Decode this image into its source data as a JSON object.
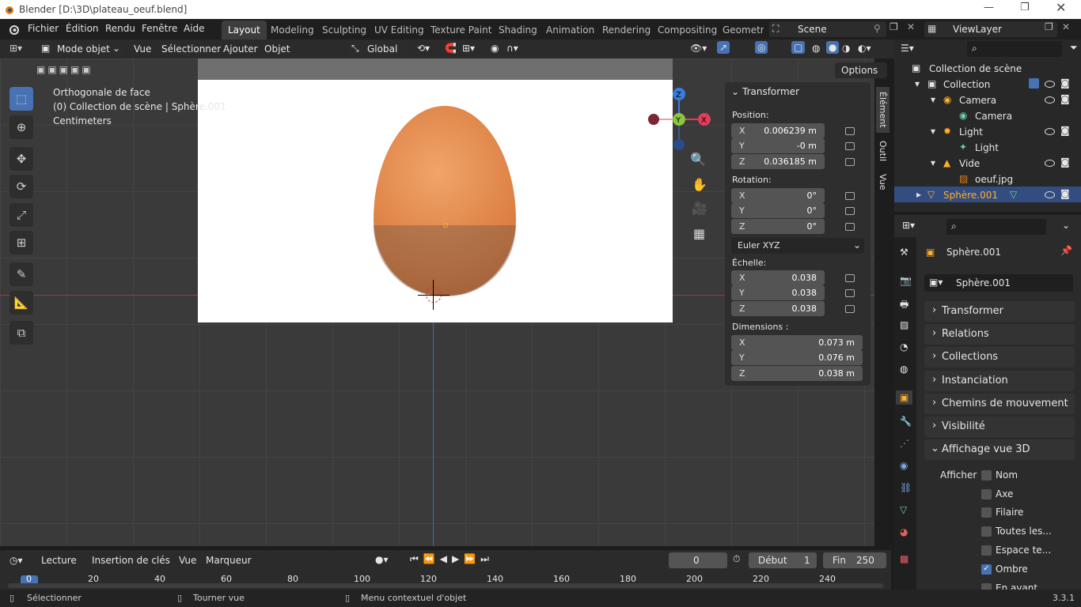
{
  "window": {
    "title": "Blender [D:\\3D\\plateau_oeuf.blend]",
    "version": "3.3.1"
  },
  "menu": [
    "Fichier",
    "Édition",
    "Rendu",
    "Fenêtre",
    "Aide"
  ],
  "workspaces": [
    "Layout",
    "Modeling",
    "Sculpting",
    "UV Editing",
    "Texture Paint",
    "Shading",
    "Animation",
    "Rendering",
    "Compositing",
    "Geometry"
  ],
  "scene": "Scene",
  "view_layer": "ViewLayer",
  "header": {
    "mode": "Mode objet",
    "vue": "Vue",
    "select": "Sélectionner",
    "add": "Ajouter",
    "object": "Objet",
    "transform": "Global",
    "options": "Options"
  },
  "viewport": {
    "title": "Orthogonale de face",
    "collection": "(0) Collection de scène | Sphère.001",
    "units": "Centimeters"
  },
  "npanel": {
    "title": "Transformer",
    "tabs": [
      "Élément",
      "Outil",
      "Vue"
    ],
    "position_label": "Position:",
    "position": [
      {
        "a": "X",
        "v": "0.006239 m"
      },
      {
        "a": "Y",
        "v": "-0 m"
      },
      {
        "a": "Z",
        "v": "0.036185 m"
      }
    ],
    "rotation_label": "Rotation:",
    "rotation": [
      {
        "a": "X",
        "v": "0°"
      },
      {
        "a": "Y",
        "v": "0°"
      },
      {
        "a": "Z",
        "v": "0°"
      }
    ],
    "euler": "Euler XYZ",
    "scale_label": "Échelle:",
    "scale": [
      {
        "a": "X",
        "v": "0.038"
      },
      {
        "a": "Y",
        "v": "0.038"
      },
      {
        "a": "Z",
        "v": "0.038"
      }
    ],
    "dims_label": "Dimensions :",
    "dims": [
      {
        "a": "X",
        "v": "0.073 m"
      },
      {
        "a": "Y",
        "v": "0.076 m"
      },
      {
        "a": "Z",
        "v": "0.038 m"
      }
    ]
  },
  "outliner": [
    "Collection de scène",
    "Collection",
    "Camera",
    "Camera",
    "Light",
    "Light",
    "Vide",
    "oeuf.jpg",
    "Sphère.001"
  ],
  "properties": {
    "object": "Sphère.001",
    "data": "Sphère.001",
    "sections": [
      "Transformer",
      "Relations",
      "Collections",
      "Instanciation",
      "Chemins de mouvement",
      "Visibilité",
      "Affichage vue 3D"
    ],
    "afficher": "Afficher",
    "checks": [
      {
        "l": "Nom",
        "on": false
      },
      {
        "l": "Axe",
        "on": false
      },
      {
        "l": "Filaire",
        "on": false
      },
      {
        "l": "Toutes les...",
        "on": false
      },
      {
        "l": "Espace te...",
        "on": false
      },
      {
        "l": "Ombre",
        "on": true
      },
      {
        "l": "En avant",
        "on": false
      }
    ]
  },
  "timeline": {
    "lecture": "Lecture",
    "keys": "Insertion de clés",
    "vue": "Vue",
    "marker": "Marqueur",
    "frame": "0",
    "start_label": "Début",
    "start": "1",
    "end_label": "Fin",
    "end": "250",
    "ticks": [
      "0",
      "20",
      "40",
      "60",
      "80",
      "100",
      "120",
      "140",
      "160",
      "180",
      "200",
      "220",
      "240"
    ]
  },
  "status": {
    "select": "Sélectionner",
    "rotate": "Tourner vue",
    "menu": "Menu contextuel d'objet"
  },
  "colors": {
    "accent": "#4772b3",
    "selected_object": "#ffaf29",
    "x_axis": "#e23d5a",
    "y_axis": "#8bc73e",
    "z_axis": "#3b7ce0"
  }
}
